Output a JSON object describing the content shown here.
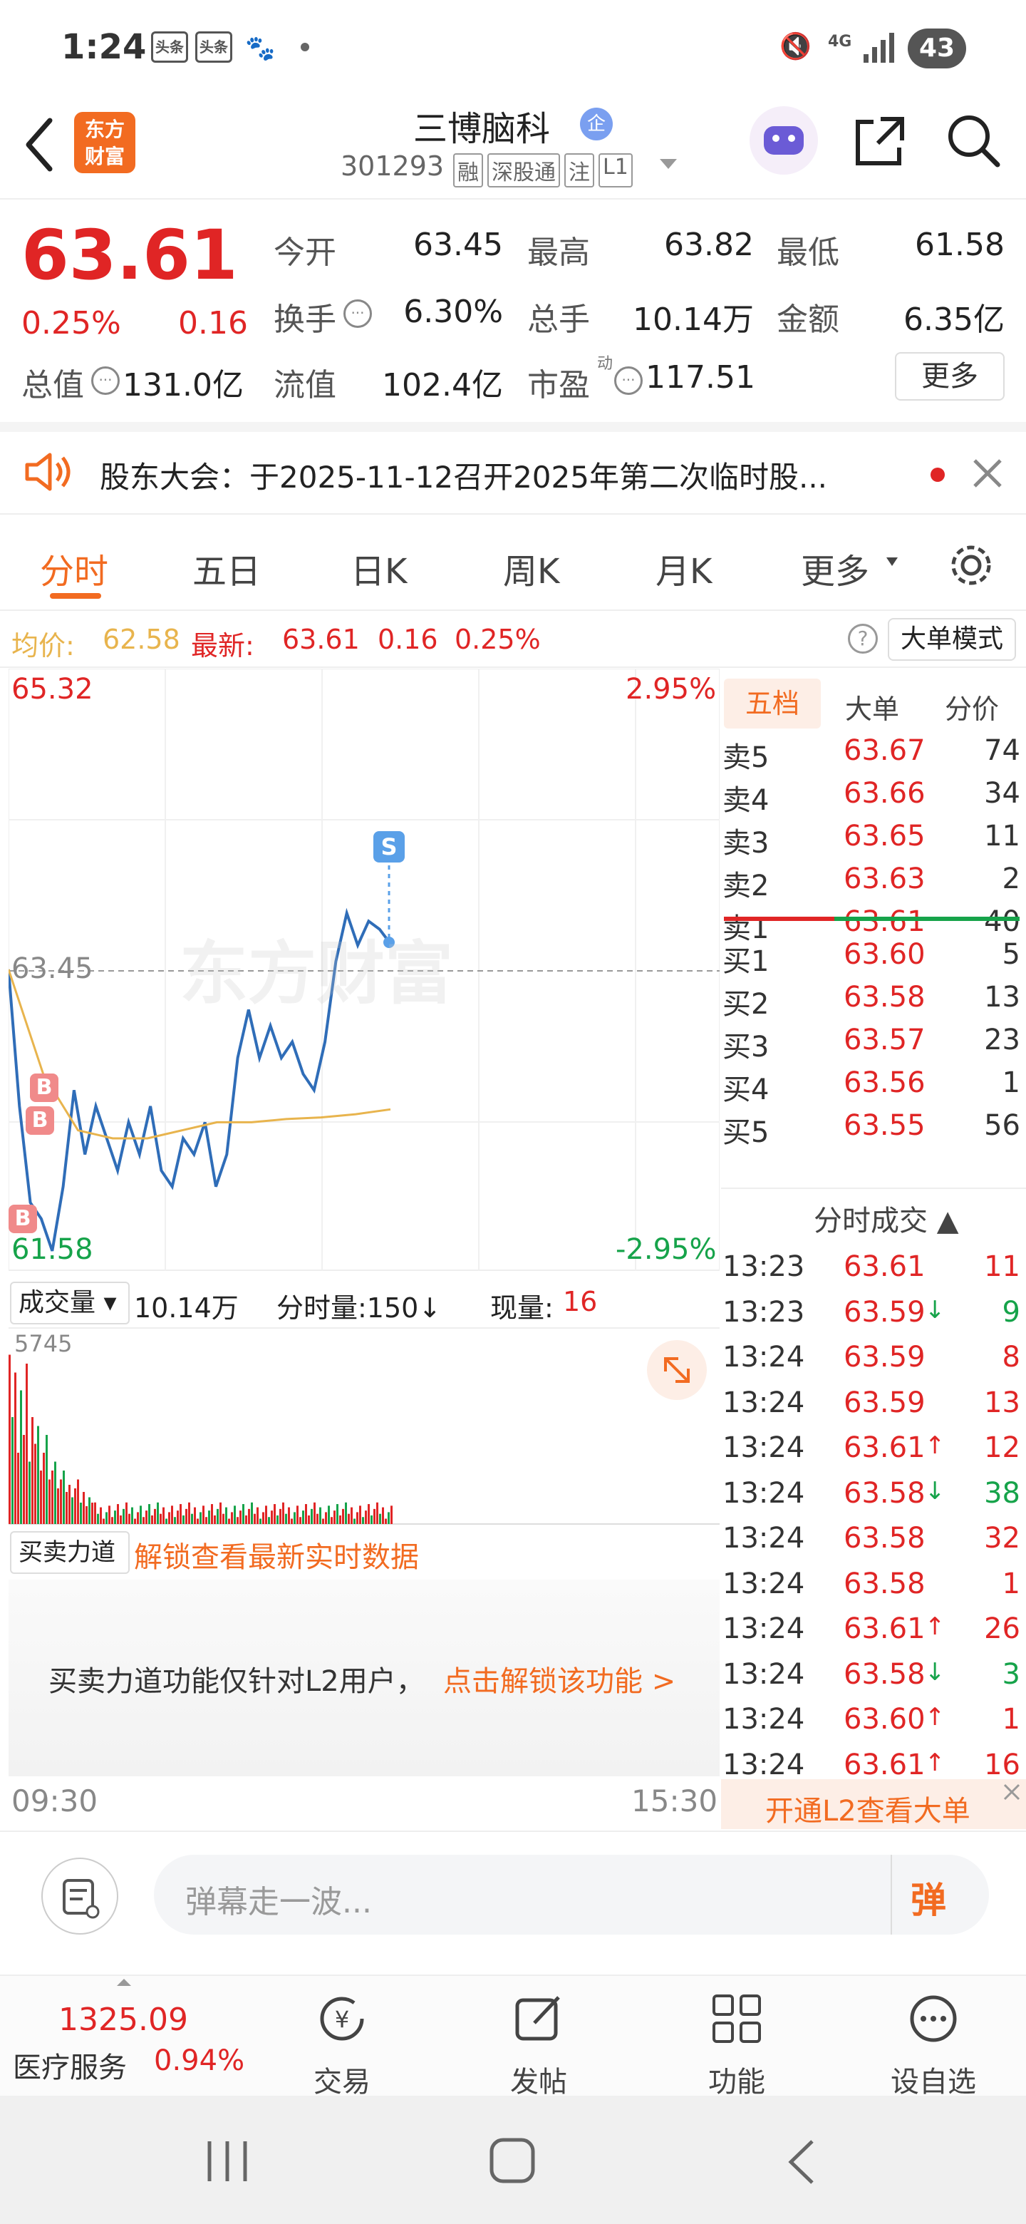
{
  "status_bar": {
    "time": "1:24",
    "chips": [
      "头条",
      "头条"
    ],
    "network": "4G",
    "battery": "43"
  },
  "header": {
    "logo_text": [
      "东方",
      "财富"
    ],
    "stock_name": "三博脑科",
    "enterprise_badge": "企",
    "stock_code": "301293",
    "tags": [
      "融",
      "深股通",
      "注",
      "L1"
    ]
  },
  "quote": {
    "price": "63.61",
    "change_pct": "0.25%",
    "change": "0.16",
    "open_label": "今开",
    "open": "63.45",
    "high_label": "最高",
    "high": "63.82",
    "low_label": "最低",
    "low": "61.58",
    "turnover_label": "换手",
    "turnover": "6.30%",
    "volume_label": "总手",
    "volume": "10.14万",
    "amount_label": "金额",
    "amount": "6.35亿",
    "mktcap_label": "总值",
    "mktcap": "131.0亿",
    "float_label": "流值",
    "float_cap": "102.4亿",
    "pe_label": "市盈",
    "pe_tag": "动",
    "pe": "117.51",
    "more_label": "更多"
  },
  "notice": {
    "text": "股东大会：于2025-11-12召开2025年第二次临时股..."
  },
  "tabs": [
    "分时",
    "五日",
    "日K",
    "周K",
    "月K",
    "更多"
  ],
  "avg_bar": {
    "avg_label": "均价:",
    "avg_value": "62.58",
    "latest_label": "最新:",
    "latest_value": "63.61",
    "latest_change": "0.16",
    "latest_pct": "0.25%",
    "big_order_mode": "大单模式"
  },
  "chart": {
    "y_top": "65.32",
    "y_mid": "63.45",
    "y_bottom": "61.58",
    "pct_top": "2.95%",
    "pct_bottom": "-2.95%",
    "watermark": "东方财富",
    "sell_marker": "S",
    "buy_marker": "B",
    "volume_label": "成交量",
    "volume_total": "10.14万",
    "minute_volume": "分时量:150↓",
    "current_volume_label": "现量:",
    "current_volume": "16",
    "volume_max": "5745",
    "force_label": "买卖力道",
    "unlock_link": "解锁查看最新实时数据",
    "l2_message": "买卖力道功能仅针对L2用户，",
    "l2_link": "点击解锁该功能 >",
    "time_start": "09:30",
    "time_end": "15:30"
  },
  "chart_data": {
    "type": "line",
    "xlabel": "",
    "ylabel": "",
    "ylim": [
      61.58,
      65.32
    ],
    "x": [
      "09:30",
      "13:24"
    ],
    "series": [
      {
        "values": [
          63.45,
          62.6,
          62.0,
          61.9,
          61.7,
          62.1,
          62.7,
          62.3,
          62.6,
          62.4,
          62.2,
          62.5,
          62.3,
          62.6,
          62.2,
          62.1,
          62.4,
          62.3,
          62.5,
          62.1,
          62.3,
          62.9,
          63.2,
          62.9,
          63.1,
          62.9,
          63.0,
          62.8,
          62.7,
          63.0,
          63.5,
          63.8,
          63.6,
          63.75,
          63.7,
          63.61
        ]
      },
      {
        "values": [
          63.45,
          62.8,
          62.45,
          62.4,
          62.4,
          62.45,
          62.5,
          62.5,
          62.52,
          62.53,
          62.55,
          62.58
        ]
      }
    ]
  },
  "order_book": {
    "tabs": [
      "五档",
      "大单",
      "分价"
    ],
    "asks": [
      {
        "label": "卖5",
        "price": "63.67",
        "vol": "74"
      },
      {
        "label": "卖4",
        "price": "63.66",
        "vol": "34"
      },
      {
        "label": "卖3",
        "price": "63.65",
        "vol": "11"
      },
      {
        "label": "卖2",
        "price": "63.63",
        "vol": "2"
      },
      {
        "label": "卖1",
        "price": "63.61",
        "vol": "40"
      }
    ],
    "bids": [
      {
        "label": "买1",
        "price": "63.60",
        "vol": "5"
      },
      {
        "label": "买2",
        "price": "63.58",
        "vol": "13"
      },
      {
        "label": "买3",
        "price": "63.57",
        "vol": "23"
      },
      {
        "label": "买4",
        "price": "63.56",
        "vol": "1"
      },
      {
        "label": "买5",
        "price": "63.55",
        "vol": "56"
      }
    ],
    "ticks_title": "分时成交",
    "ticks": [
      {
        "time": "13:23",
        "price": "63.61",
        "arrow": "",
        "vol": "11",
        "dir": "up"
      },
      {
        "time": "13:23",
        "price": "63.59",
        "arrow": "↓",
        "vol": "9",
        "dir": "down"
      },
      {
        "time": "13:24",
        "price": "63.59",
        "arrow": "",
        "vol": "8",
        "dir": "up"
      },
      {
        "time": "13:24",
        "price": "63.59",
        "arrow": "",
        "vol": "13",
        "dir": "up"
      },
      {
        "time": "13:24",
        "price": "63.61",
        "arrow": "↑",
        "vol": "12",
        "dir": "up"
      },
      {
        "time": "13:24",
        "price": "63.58",
        "arrow": "↓",
        "vol": "38",
        "dir": "down"
      },
      {
        "time": "13:24",
        "price": "63.58",
        "arrow": "",
        "vol": "32",
        "dir": "up"
      },
      {
        "time": "13:24",
        "price": "63.58",
        "arrow": "",
        "vol": "1",
        "dir": "up"
      },
      {
        "time": "13:24",
        "price": "63.61",
        "arrow": "↑",
        "vol": "26",
        "dir": "up"
      },
      {
        "time": "13:24",
        "price": "63.58",
        "arrow": "↓",
        "vol": "3",
        "dir": "down"
      },
      {
        "time": "13:24",
        "price": "63.60",
        "arrow": "↑",
        "vol": "1",
        "dir": "up"
      },
      {
        "time": "13:24",
        "price": "63.61",
        "arrow": "↑",
        "vol": "16",
        "dir": "up"
      }
    ],
    "l2_banner": "开通L2查看大单"
  },
  "comment_bar": {
    "placeholder": "弹幕走一波...",
    "danmu_label": "弹"
  },
  "nav": {
    "index_value": "1325.09",
    "index_name": "医疗服务",
    "index_pct": "0.94%",
    "items": [
      "交易",
      "发帖",
      "功能",
      "设自选"
    ]
  },
  "colors": {
    "up": "#e02525",
    "down": "#16a34a",
    "accent": "#f26b21",
    "line": "#2f6db8",
    "avg": "#e8b44d"
  }
}
